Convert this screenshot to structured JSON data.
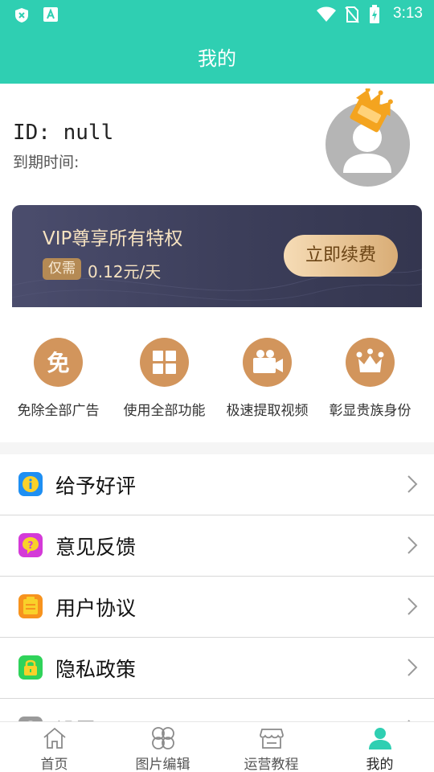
{
  "status_bar": {
    "time": "3:13"
  },
  "header": {
    "title": "我的"
  },
  "profile": {
    "user_id": "ID: null",
    "expire_label": "到期时间:",
    "badge_icon": "crown-icon"
  },
  "vip_card": {
    "title": "VIP尊享所有特权",
    "tag": "仅需",
    "price": "0.12元/天",
    "renew_label": "立即续费"
  },
  "perks": [
    {
      "label": "免除全部广告",
      "icon": "free-icon"
    },
    {
      "label": "使用全部功能",
      "icon": "grid-icon"
    },
    {
      "label": "极速提取视频",
      "icon": "video-camera-icon"
    },
    {
      "label": "彰显贵族身份",
      "icon": "crown-icon"
    }
  ],
  "menu": [
    {
      "label": "给予好评",
      "icon": "info-icon",
      "color": "#1e8ff3"
    },
    {
      "label": "意见反馈",
      "icon": "question-icon",
      "color": "#d43ad8"
    },
    {
      "label": "用户协议",
      "icon": "document-icon",
      "color": "#f7931e"
    },
    {
      "label": "隐私政策",
      "icon": "lock-icon",
      "color": "#2fd35a"
    },
    {
      "label": "设置",
      "icon": "settings-icon",
      "color": "#9a9a9a"
    }
  ],
  "bottom_nav": [
    {
      "label": "首页",
      "icon": "home-icon",
      "active": false
    },
    {
      "label": "图片编辑",
      "icon": "clover-icon",
      "active": false
    },
    {
      "label": "运营教程",
      "icon": "store-icon",
      "active": false
    },
    {
      "label": "我的",
      "icon": "user-icon",
      "active": true
    }
  ],
  "colors": {
    "accent": "#2fcfb2",
    "gold": "#d2955c",
    "vip_bg": "#3f415e"
  }
}
